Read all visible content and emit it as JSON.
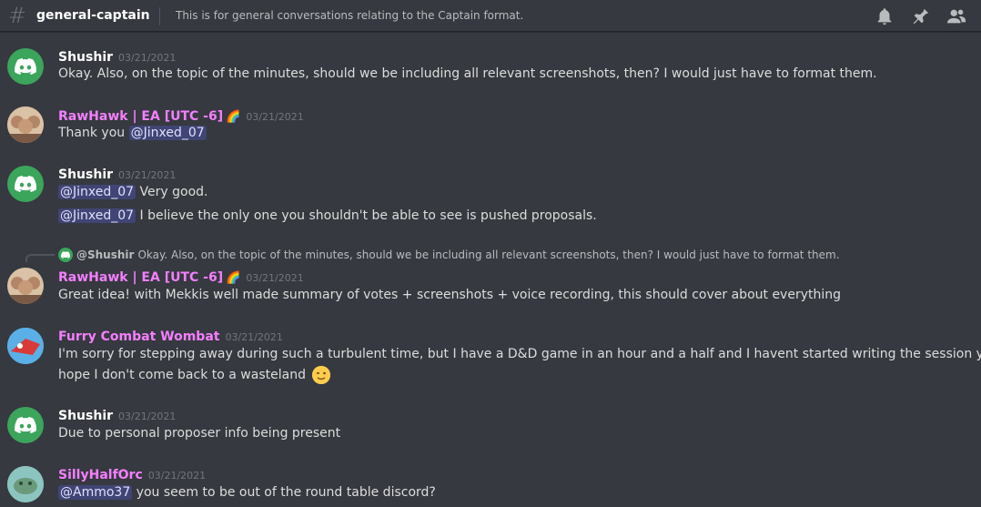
{
  "header": {
    "hash_symbol": "#",
    "channel_name": "general-captain",
    "topic": "This is for general conversations relating to the Captain format.",
    "icons": [
      "bell-icon",
      "pin-icon",
      "members-icon"
    ]
  },
  "colors": {
    "background": "#36393f",
    "shushir_avatar": "#3ba55c",
    "pink_name": "#f47fff",
    "mention_bg": "#5865f2"
  },
  "messages": [
    {
      "author": "Shushir",
      "timestamp": "03/21/2021",
      "lines": [
        "Okay. Also, on the topic of the minutes, should we be including all relevant screenshots, then? I would just have to format them."
      ]
    },
    {
      "author": "RawHawk | EA [UTC -6]",
      "flag": "🌈",
      "timestamp": "03/21/2021",
      "mention": "@Jinxed_07",
      "line_prefix": "Thank you"
    },
    {
      "author": "Shushir",
      "timestamp": "03/21/2021",
      "line1_mention": "@Jinxed_07",
      "line1_text": "Very good.",
      "line2_mention": "@Jinxed_07",
      "line2_text": "I believe the only one you shouldn't be able to see is pushed proposals."
    },
    {
      "reply_author": "@Shushir",
      "reply_text": "Okay. Also, on the topic of the minutes, should we be including all relevant screenshots, then? I would just have to format them.",
      "author": "RawHawk | EA [UTC -6]",
      "flag": "🌈",
      "timestamp": "03/21/2021",
      "text": "Great idea! with Mekkis well made summary of votes + screenshots + voice recording, this should cover about everything"
    },
    {
      "author": "Furry Combat Wombat",
      "timestamp": "03/21/2021",
      "line1": "I'm sorry for stepping away during such a turbulent time, but I have a D&D game in an hour and a half and I havent started writing the session yet. I",
      "line2": "hope I don't come back to a wasteland",
      "emoji": "wink-emoji"
    },
    {
      "author": "Shushir",
      "timestamp": "03/21/2021",
      "text": "Due to personal proposer info being present"
    },
    {
      "author": "SillyHalfOrc",
      "timestamp": "03/21/2021",
      "mention": "@Ammo37",
      "text": "you seem to be out of the round table discord?"
    }
  ]
}
